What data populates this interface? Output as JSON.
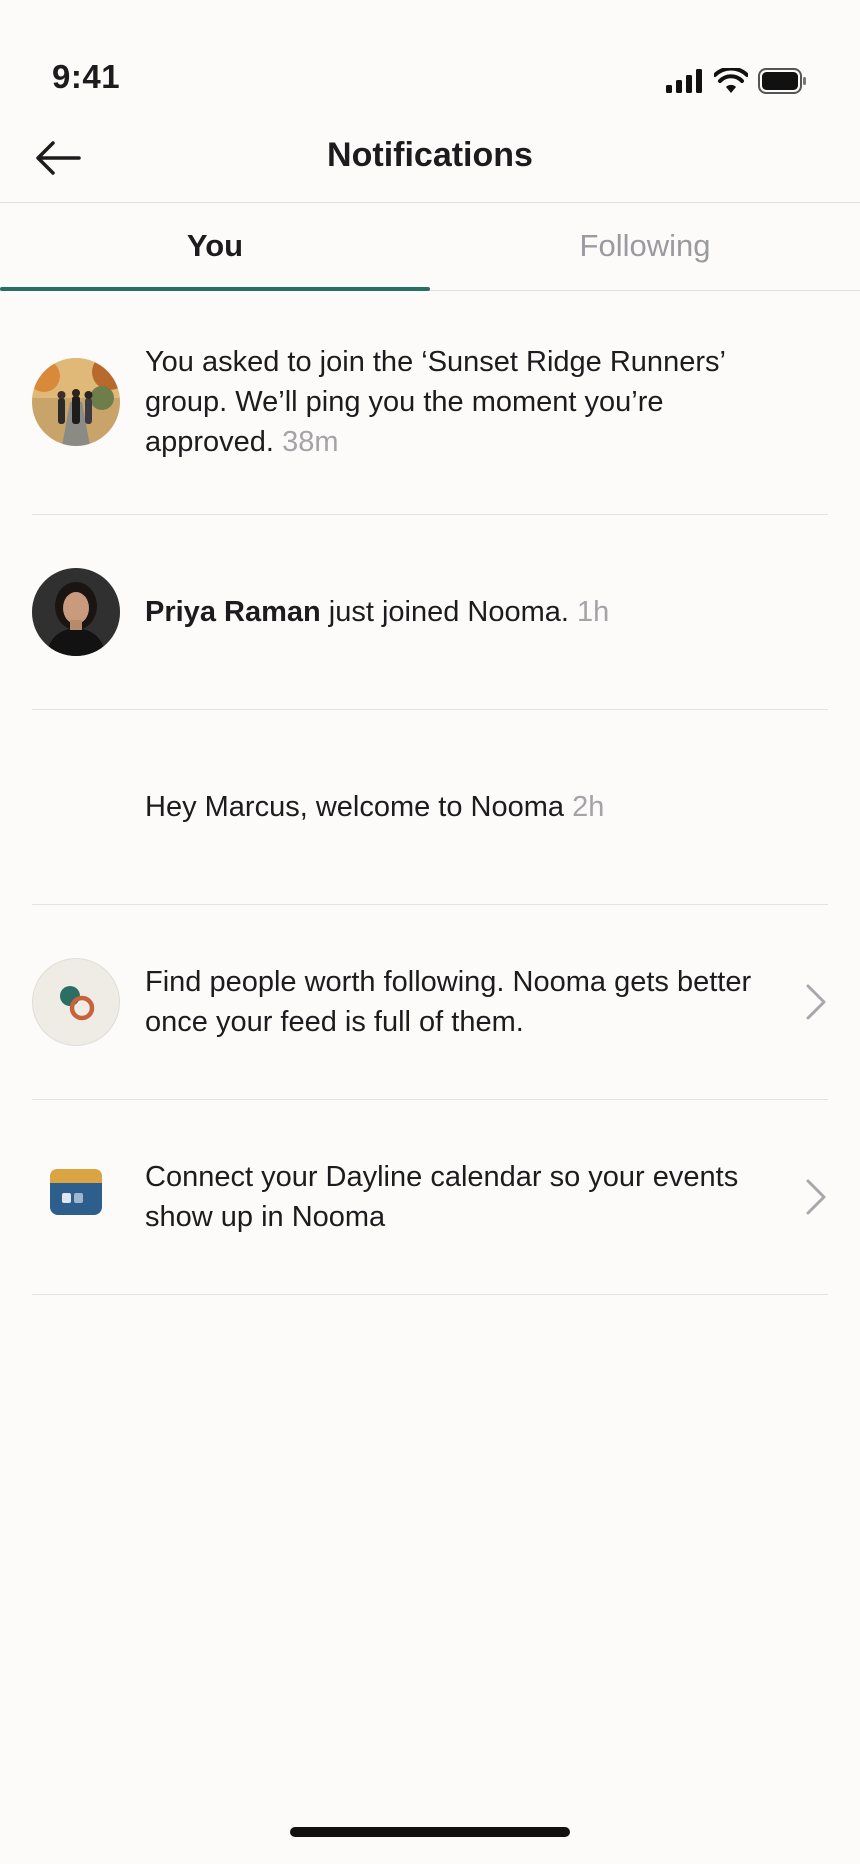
{
  "status_bar": {
    "time": "9:41"
  },
  "header": {
    "title": "Notifications"
  },
  "tabs": [
    {
      "label": "You",
      "active": true
    },
    {
      "label": "Following",
      "active": false
    }
  ],
  "notifications": [
    {
      "text": "You asked to join the ‘Sunset Ridge Runners’ group. We’ll ping you the moment you’re approved.",
      "time": "38m",
      "icon": "group-photo-avatar"
    },
    {
      "name": "Priya Raman",
      "text": "just joined Nooma.",
      "time": "1h",
      "icon": "user-avatar"
    },
    {
      "text": "Hey Marcus, welcome to Nooma",
      "time": "2h"
    },
    {
      "text": "Find people worth following. Nooma gets better once your feed is full of them.",
      "icon": "follow-suggestion-icon"
    },
    {
      "text": "Connect your Dayline calendar so your events show up in Nooma",
      "icon": "calendar-icon"
    }
  ],
  "colors": {
    "accent": "#2b6e63",
    "background": "#fcfbfa",
    "muted_text": "#a4a3a8",
    "calendar_top": "#d9a441",
    "calendar_body": "#2e5f8c",
    "follow_ring": "#c8623a"
  }
}
